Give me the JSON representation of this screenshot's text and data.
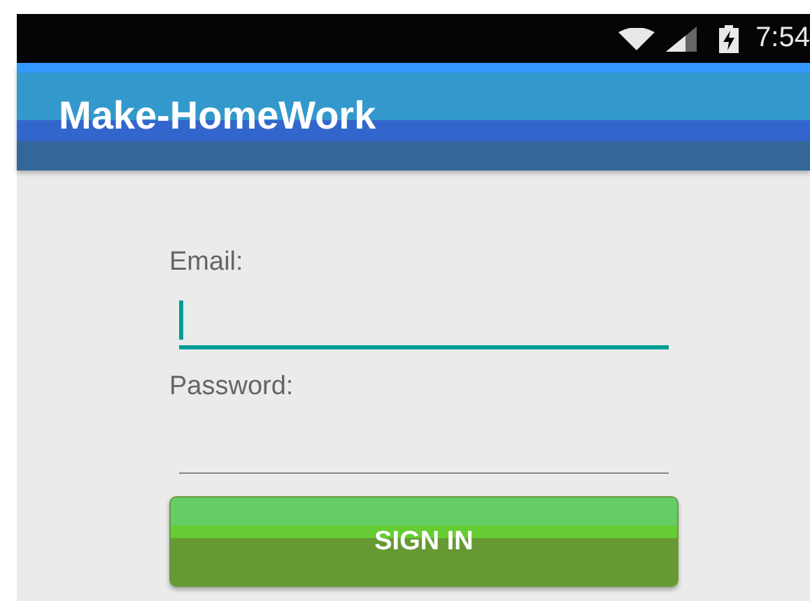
{
  "status_bar": {
    "time": "7:54"
  },
  "app_bar": {
    "title": "Make-HomeWork"
  },
  "fields": [
    {
      "label": "Email:",
      "focused": true
    },
    {
      "label": "Password:",
      "focused": false
    }
  ],
  "button": {
    "label": "SIGN IN"
  }
}
